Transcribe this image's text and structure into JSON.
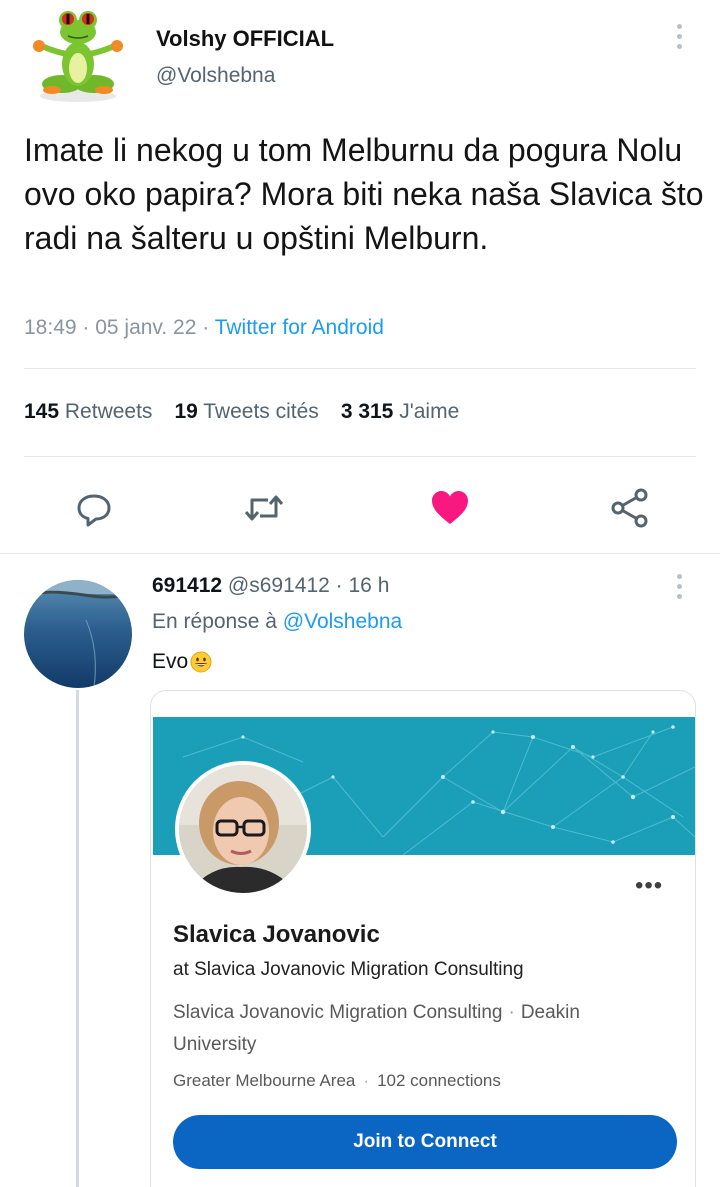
{
  "tweet": {
    "author_name": "Volshy OFFICIAL",
    "author_handle": "@Volshebna",
    "text": "Imate li nekog u tom Melburnu da pogura Nolu ovo oko papira? Mora biti neka naša Slavica što radi na šalteru u opštini Melburn.",
    "time": "18:49 · 05 janv. 22 · ",
    "source": "Twitter for Android",
    "stats": {
      "retweets_count": "145",
      "retweets_label": "Retweets",
      "quotes_count": "19",
      "quotes_label": "Tweets cités",
      "likes_count": "3 315",
      "likes_label": "J'aime"
    },
    "actions": {
      "reply_icon": "reply-icon",
      "retweet_icon": "retweet-icon",
      "like_icon": "heart-icon",
      "share_icon": "share-icon",
      "like_color": "#f91880"
    }
  },
  "reply": {
    "author_name": "691412",
    "author_handle": "@s691412",
    "time": "· 16 h",
    "reply_prefix": "En réponse à",
    "reply_mention": "@Volshebna",
    "text": "Evo",
    "emoji": "grinning-face-icon"
  },
  "linkedin_card": {
    "name": "Slavica Jovanovic",
    "headline": "at Slavica Jovanovic Migration Consulting",
    "company": "Slavica Jovanovic Migration Consulting",
    "separator": "·",
    "school": "Deakin University",
    "location": "Greater Melbourne Area",
    "connections": "102 connections",
    "more_label": "•••",
    "join_label": "Join to Connect",
    "accent_color": "#0a66c2",
    "banner_color": "#1b9fb8"
  }
}
